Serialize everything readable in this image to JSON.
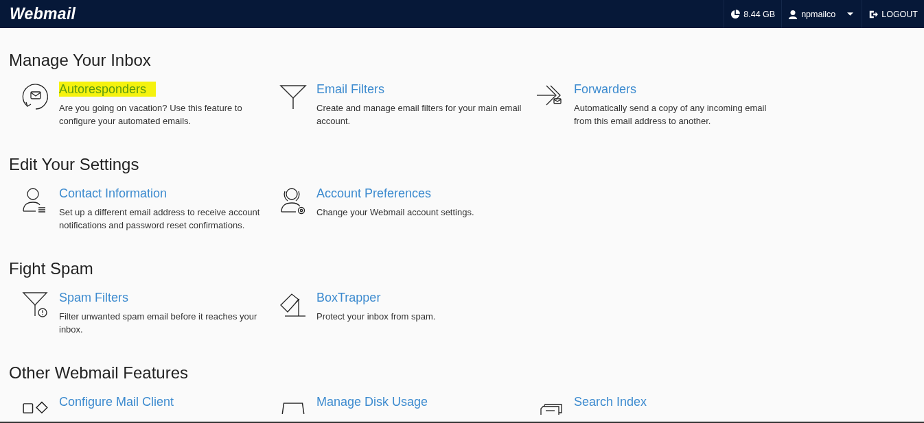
{
  "header": {
    "logo": "Webmail",
    "disk_usage": "8.44 GB",
    "user": "npmailco",
    "logout": "LOGOUT"
  },
  "sections": [
    {
      "title": "Manage Your Inbox",
      "items": [
        {
          "title": "Autoresponders",
          "description": "Are you going on vacation? Use this feature to configure your automated emails.",
          "highlighted": true
        },
        {
          "title": "Email Filters",
          "description": "Create and manage email filters for your main email account.",
          "highlighted": false
        },
        {
          "title": "Forwarders",
          "description": "Automatically send a copy of any incoming email from this email address to another.",
          "highlighted": false
        }
      ]
    },
    {
      "title": "Edit Your Settings",
      "items": [
        {
          "title": "Contact Information",
          "description": "Set up a different email address to receive account notifications and password reset confirmations.",
          "highlighted": false
        },
        {
          "title": "Account Preferences",
          "description": "Change your Webmail account settings.",
          "highlighted": false
        }
      ]
    },
    {
      "title": "Fight Spam",
      "items": [
        {
          "title": "Spam Filters",
          "description": "Filter unwanted spam email before it reaches your inbox.",
          "highlighted": false
        },
        {
          "title": "BoxTrapper",
          "description": "Protect your inbox from spam.",
          "highlighted": false
        }
      ]
    },
    {
      "title": "Other Webmail Features",
      "items": [
        {
          "title": "Configure Mail Client",
          "highlighted": false
        },
        {
          "title": "Manage Disk Usage",
          "highlighted": false
        },
        {
          "title": "Search Index",
          "highlighted": false
        }
      ]
    }
  ]
}
